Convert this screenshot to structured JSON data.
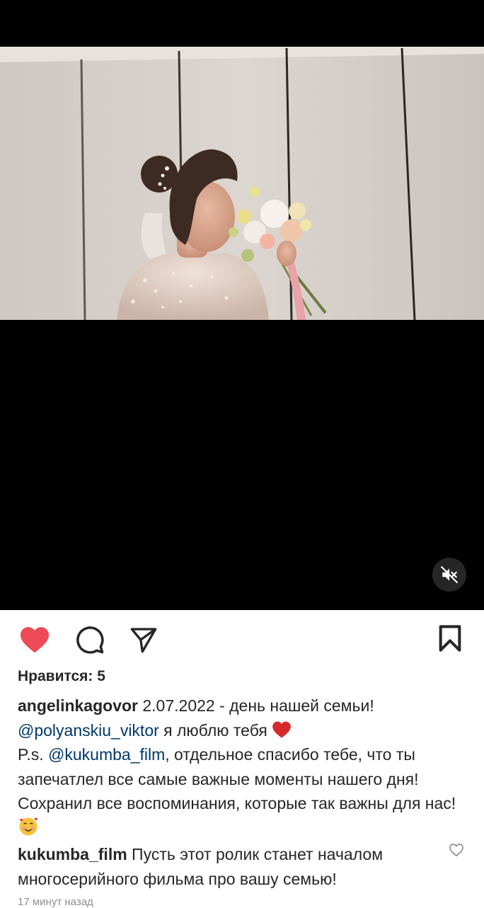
{
  "post": {
    "likes_label": "Нравится: 5",
    "caption": {
      "username": "angelinkagovor",
      "text_1": " 2.07.2022 - день нашей семьи!",
      "mention_1": "@polyanskiu_viktor",
      "text_2": " я люблю тебя ",
      "text_3": "P.s. ",
      "mention_2": "@kukumba_film",
      "text_4": ", отдельное спасибо тебе, что ты запечатлел все самые важные моменты нашего дня! Сохранил все воспоминания, которые так важны для нас! "
    },
    "comment": {
      "username": "kukumba_film",
      "text": " Пусть этот ролик станет началом многосерийного фильма про вашу семью!"
    },
    "timestamp": "17 минут назад"
  },
  "icons": {
    "like": "heart-filled-icon",
    "comment": "speech-bubble-icon",
    "share": "paper-plane-icon",
    "save": "bookmark-icon",
    "mute": "speaker-muted-icon",
    "comment_like": "heart-outline-icon"
  },
  "colors": {
    "like_red": "#ed4956",
    "mention_blue": "#00376b",
    "text": "#262626",
    "muted": "#8e8e8e"
  }
}
